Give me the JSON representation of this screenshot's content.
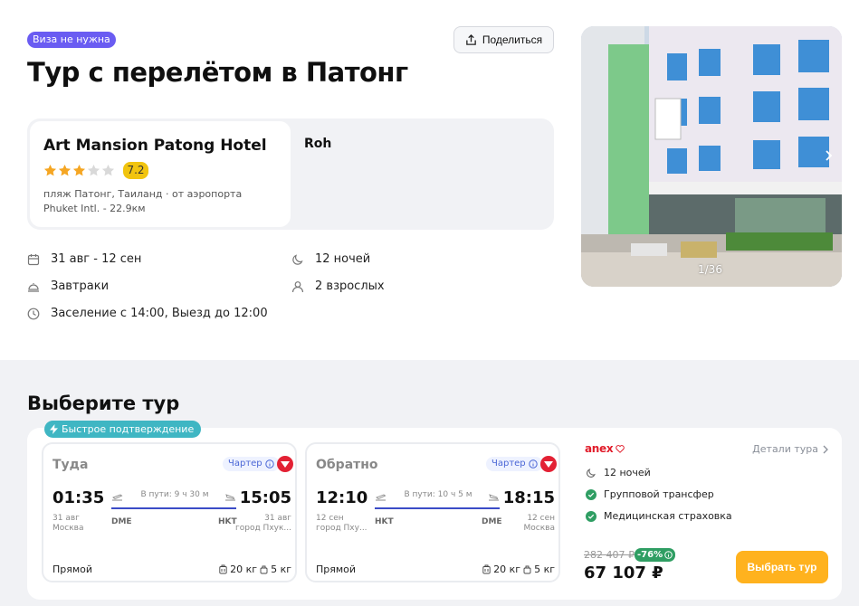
{
  "header": {
    "visa_badge": "Виза не нужна",
    "share_label": "Поделиться",
    "title": "Тур с перелётом в Патонг"
  },
  "hotel": {
    "name": "Art Mansion Patong Hotel",
    "stars": 3,
    "stars_max": 5,
    "rating": "7.2",
    "address": "пляж Патонг, Таиланд · от аэропорта Phuket Intl. - 22.9км",
    "room": "Roh"
  },
  "details": {
    "dates": "31 авг - 12 сен",
    "nights": "12 ночей",
    "meals": "Завтраки",
    "guests": "2 взрослых",
    "checkin": "Заселение с 14:00, Выезд до 12:00"
  },
  "gallery": {
    "counter": "1/36"
  },
  "tours": {
    "title": "Выберите тур",
    "fast_badge": "Быстрое подтверждение",
    "outbound": {
      "label": "Туда",
      "charter": "Чартер",
      "dep_time": "01:35",
      "arr_time": "15:05",
      "duration": "В пути: 9 ч 30 м",
      "dep_date": "31 авг",
      "dep_city": "Москва",
      "arr_date": "31 авг",
      "arr_city": "город Пхук...",
      "dep_code": "DME",
      "arr_code": "HKT",
      "type": "Прямой",
      "baggage": "20 кг",
      "hand": "5 кг"
    },
    "return": {
      "label": "Обратно",
      "charter": "Чартер",
      "dep_time": "12:10",
      "arr_time": "18:15",
      "duration": "В пути: 10 ч 5 м",
      "dep_date": "12 сен",
      "dep_city": "город Пху...",
      "arr_date": "12 сен",
      "arr_city": "Москва",
      "dep_code": "HKT",
      "arr_code": "DME",
      "type": "Прямой",
      "baggage": "20 кг",
      "hand": "5 кг"
    },
    "offer": {
      "operator": "anex",
      "details_link": "Детали тура",
      "nights": "12 ночей",
      "transfer": "Групповой трансфер",
      "insurance": "Медицинская страховка",
      "old_price": "282 407 ₽",
      "discount": "-76%",
      "price": "67 107 ₽",
      "choose_label": "Выбрать тур"
    }
  },
  "colors": {
    "visa_badge": "#6a5cf2",
    "rating": "#f1c40f",
    "fast_badge": "#3fb6c3",
    "flight_line": "#3b4cc7",
    "discount": "#2f9e63",
    "cta": "#ffb21e",
    "star_on": "#f5a623",
    "star_off": "#d9d9d9"
  }
}
